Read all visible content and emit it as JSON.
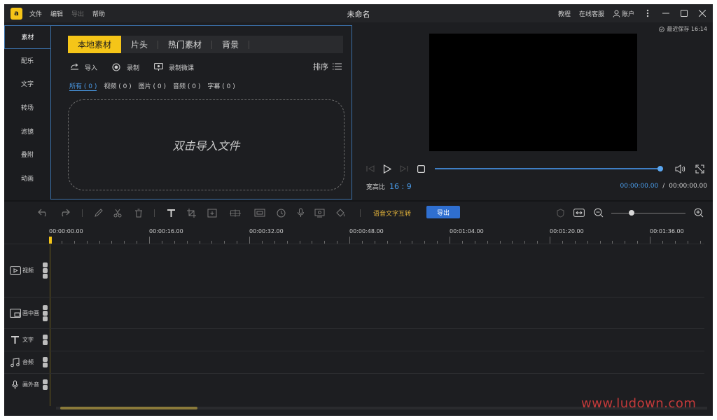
{
  "window": {
    "title": "未命名",
    "logo_glyph": "a",
    "menu": [
      {
        "label": "文件",
        "enabled": true
      },
      {
        "label": "编辑",
        "enabled": true
      },
      {
        "label": "导出",
        "enabled": false
      },
      {
        "label": "帮助",
        "enabled": true
      }
    ],
    "right": {
      "tutorial": "教程",
      "support": "在线客服",
      "account": "账户"
    }
  },
  "sidebar": {
    "items": [
      {
        "label": "素材",
        "active": true
      },
      {
        "label": "配乐",
        "active": false
      },
      {
        "label": "文字",
        "active": false
      },
      {
        "label": "转场",
        "active": false
      },
      {
        "label": "滤镜",
        "active": false
      },
      {
        "label": "叠附",
        "active": false
      },
      {
        "label": "动画",
        "active": false
      }
    ]
  },
  "media": {
    "tabs": [
      {
        "label": "本地素材",
        "active": true
      },
      {
        "label": "片头",
        "active": false
      },
      {
        "label": "热门素材",
        "active": false
      },
      {
        "label": "背景",
        "active": false
      }
    ],
    "tools": {
      "import": "导入",
      "record": "录制",
      "record_lecture": "录制微课"
    },
    "sort_label": "排序",
    "filters": [
      {
        "label": "所有 ( 0 )",
        "active": true
      },
      {
        "label": "视频 ( 0 )",
        "active": false
      },
      {
        "label": "图片 ( 0 )",
        "active": false
      },
      {
        "label": "音频 ( 0 )",
        "active": false
      },
      {
        "label": "字幕 ( 0 )",
        "active": false
      }
    ],
    "dropzone_text": "双击导入文件"
  },
  "preview": {
    "autosave": "最近保存 16:14",
    "aspect_label": "宽高比",
    "aspect_value": "16 : 9",
    "current_time": "00:00:00.00",
    "separator": "/",
    "total_time": "00:00:00.00",
    "progress": 1.0
  },
  "timeline": {
    "speech_to_text": "语音文字互转",
    "export_label": "导出",
    "zoom_level": 0.27,
    "ruler_labels": [
      "00:00:00.00",
      "00:00:16.00",
      "00:00:32.00",
      "00:00:48.00",
      "00:01:04.00",
      "00:01:20.00",
      "00:01:36.00"
    ],
    "tracks": [
      {
        "label": "视频",
        "icon": "video-track-icon"
      },
      {
        "label": "画中画",
        "icon": "pip-track-icon"
      },
      {
        "label": "文字",
        "icon": "text-track-icon"
      },
      {
        "label": "音频",
        "icon": "music-track-icon"
      },
      {
        "label": "画外音",
        "icon": "mic-track-icon"
      }
    ]
  },
  "watermark": "www.ludown.com",
  "colors": {
    "accent": "#f5c518",
    "link": "#4a9be8",
    "export": "#2f6fd0",
    "background": "#1d1e21"
  }
}
